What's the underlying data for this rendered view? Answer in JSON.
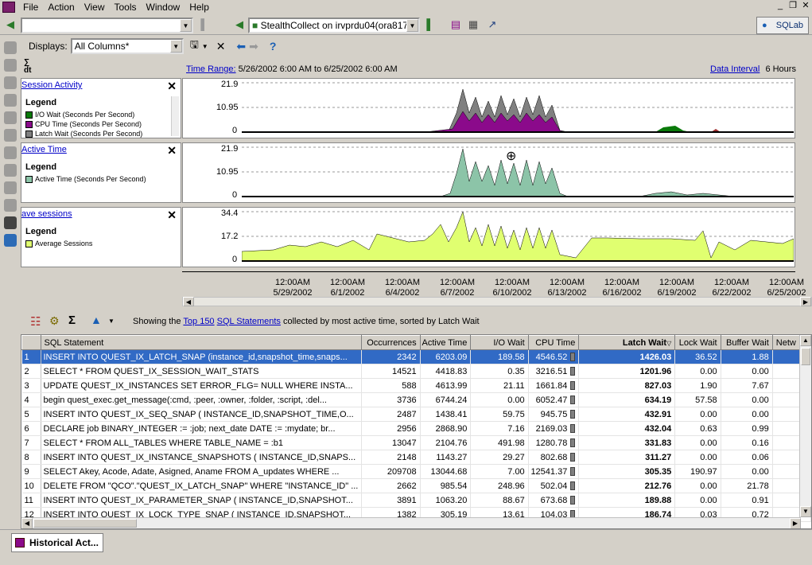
{
  "menu": [
    "File",
    "Action",
    "View",
    "Tools",
    "Window",
    "Help"
  ],
  "toolbar1": {
    "connection_combo": "StealthCollect on irvprdu04(ora817)",
    "brand": "SQLab"
  },
  "toolbar2": {
    "displays_label": "Displays:",
    "displays_value": "All Columns*"
  },
  "time_bar": {
    "time_range_label": "Time Range:",
    "time_range_value": "5/26/2002 6:00 AM to 6/25/2002 6:00 AM",
    "data_interval_label": "Data Interval",
    "data_interval_value": "6 Hours"
  },
  "panels": [
    {
      "title": "Session Activity",
      "legend": "Legend",
      "items": [
        {
          "label": "I/O Wait (Seconds Per Second)",
          "color": "#0a7a0a"
        },
        {
          "label": "CPU Time (Seconds Per Second)",
          "color": "#8b0a8b"
        },
        {
          "label": "Latch Wait (Seconds Per Second)",
          "color": "#808080"
        }
      ],
      "ymax": "21.9",
      "ymid": "10.95",
      "ymin": "0"
    },
    {
      "title": "Active Time",
      "legend": "Legend",
      "items": [
        {
          "label": "Active Time (Seconds Per Second)",
          "color": "#8cc4a8"
        }
      ],
      "ymax": "21.9",
      "ymid": "10.95",
      "ymin": "0"
    },
    {
      "title": "ave sessions",
      "legend": "Legend",
      "items": [
        {
          "label": "Average Sessions",
          "color": "#e0ff70"
        }
      ],
      "ymax": "34.4",
      "ymid": "17.2",
      "ymin": "0"
    }
  ],
  "timeline_ticks": [
    {
      "time": "12:00AM",
      "date": "5/29/2002"
    },
    {
      "time": "12:00AM",
      "date": "6/1/2002"
    },
    {
      "time": "12:00AM",
      "date": "6/4/2002"
    },
    {
      "time": "12:00AM",
      "date": "6/7/2002"
    },
    {
      "time": "12:00AM",
      "date": "6/10/2002"
    },
    {
      "time": "12:00AM",
      "date": "6/13/2002"
    },
    {
      "time": "12:00AM",
      "date": "6/16/2002"
    },
    {
      "time": "12:00AM",
      "date": "6/19/2002"
    },
    {
      "time": "12:00AM",
      "date": "6/22/2002"
    },
    {
      "time": "12:00AM",
      "date": "6/25/2002"
    }
  ],
  "grid_info": {
    "prefix": "Showing the",
    "link1": "Top 150",
    "link2": "SQL Statements",
    "suffix": "collected by most active time, sorted by Latch Wait"
  },
  "columns": [
    "",
    "SQL Statement",
    "Occurrences",
    "Active Time",
    "I/O Wait",
    "CPU Time",
    "Latch Wait",
    "Lock Wait",
    "Buffer Wait",
    "Netw"
  ],
  "rows": [
    {
      "n": "1",
      "sql": "INSERT INTO QUEST_IX_LATCH_SNAP (instance_id,snapshot_time,snaps...",
      "occ": "2342",
      "active": "6203.09",
      "io": "189.58",
      "cpu": "4546.52",
      "latch": "1426.03",
      "lock": "36.52",
      "buf": "1.88"
    },
    {
      "n": "2",
      "sql": "SELECT * FROM QUEST_IX_SESSION_WAIT_STATS",
      "occ": "14521",
      "active": "4418.83",
      "io": "0.35",
      "cpu": "3216.51",
      "latch": "1201.96",
      "lock": "0.00",
      "buf": "0.00"
    },
    {
      "n": "3",
      "sql": "UPDATE QUEST_IX_INSTANCES SET ERROR_FLG= NULL WHERE INSTA...",
      "occ": "588",
      "active": "4613.99",
      "io": "21.11",
      "cpu": "1661.84",
      "latch": "827.03",
      "lock": "1.90",
      "buf": "7.67"
    },
    {
      "n": "4",
      "sql": "begin quest_exec.get_message(:cmd, :peer, :owner, :folder, :script, :del...",
      "occ": "3736",
      "active": "6744.24",
      "io": "0.00",
      "cpu": "6052.47",
      "latch": "634.19",
      "lock": "57.58",
      "buf": "0.00"
    },
    {
      "n": "5",
      "sql": "INSERT INTO QUEST_IX_SEQ_SNAP ( INSTANCE_ID,SNAPSHOT_TIME,O...",
      "occ": "2487",
      "active": "1438.41",
      "io": "59.75",
      "cpu": "945.75",
      "latch": "432.91",
      "lock": "0.00",
      "buf": "0.00"
    },
    {
      "n": "6",
      "sql": "DECLARE job BINARY_INTEGER := :job; next_date DATE := :mydate; br...",
      "occ": "2956",
      "active": "2868.90",
      "io": "7.16",
      "cpu": "2169.03",
      "latch": "432.04",
      "lock": "0.63",
      "buf": "0.99"
    },
    {
      "n": "7",
      "sql": "SELECT * FROM ALL_TABLES WHERE TABLE_NAME = :b1",
      "occ": "13047",
      "active": "2104.76",
      "io": "491.98",
      "cpu": "1280.78",
      "latch": "331.83",
      "lock": "0.00",
      "buf": "0.16"
    },
    {
      "n": "8",
      "sql": "INSERT INTO QUEST_IX_INSTANCE_SNAPSHOTS ( INSTANCE_ID,SNAPS...",
      "occ": "2148",
      "active": "1143.27",
      "io": "29.27",
      "cpu": "802.68",
      "latch": "311.27",
      "lock": "0.00",
      "buf": "0.06"
    },
    {
      "n": "9",
      "sql": "SELECT Akey, Acode, Adate, Asigned, Aname FROM A_updates WHERE ...",
      "occ": "209708",
      "active": "13044.68",
      "io": "7.00",
      "cpu": "12541.37",
      "latch": "305.35",
      "lock": "190.97",
      "buf": "0.00"
    },
    {
      "n": "10",
      "sql": "DELETE FROM \"QCO\".\"QUEST_IX_LATCH_SNAP\" WHERE \"INSTANCE_ID\" ...",
      "occ": "2662",
      "active": "985.54",
      "io": "248.96",
      "cpu": "502.04",
      "latch": "212.76",
      "lock": "0.00",
      "buf": "21.78"
    },
    {
      "n": "11",
      "sql": "INSERT INTO QUEST_IX_PARAMETER_SNAP ( INSTANCE_ID,SNAPSHOT...",
      "occ": "3891",
      "active": "1063.20",
      "io": "88.67",
      "cpu": "673.68",
      "latch": "189.88",
      "lock": "0.00",
      "buf": "0.91"
    },
    {
      "n": "12",
      "sql": "INSERT INTO QUEST_IX_LOCK_TYPE_SNAP ( INSTANCE_ID,SNAPSHOT...",
      "occ": "1382",
      "active": "305.19",
      "io": "13.61",
      "cpu": "104.03",
      "latch": "186.74",
      "lock": "0.03",
      "buf": "0.72"
    }
  ],
  "bottom_tab": "Historical Act..."
}
